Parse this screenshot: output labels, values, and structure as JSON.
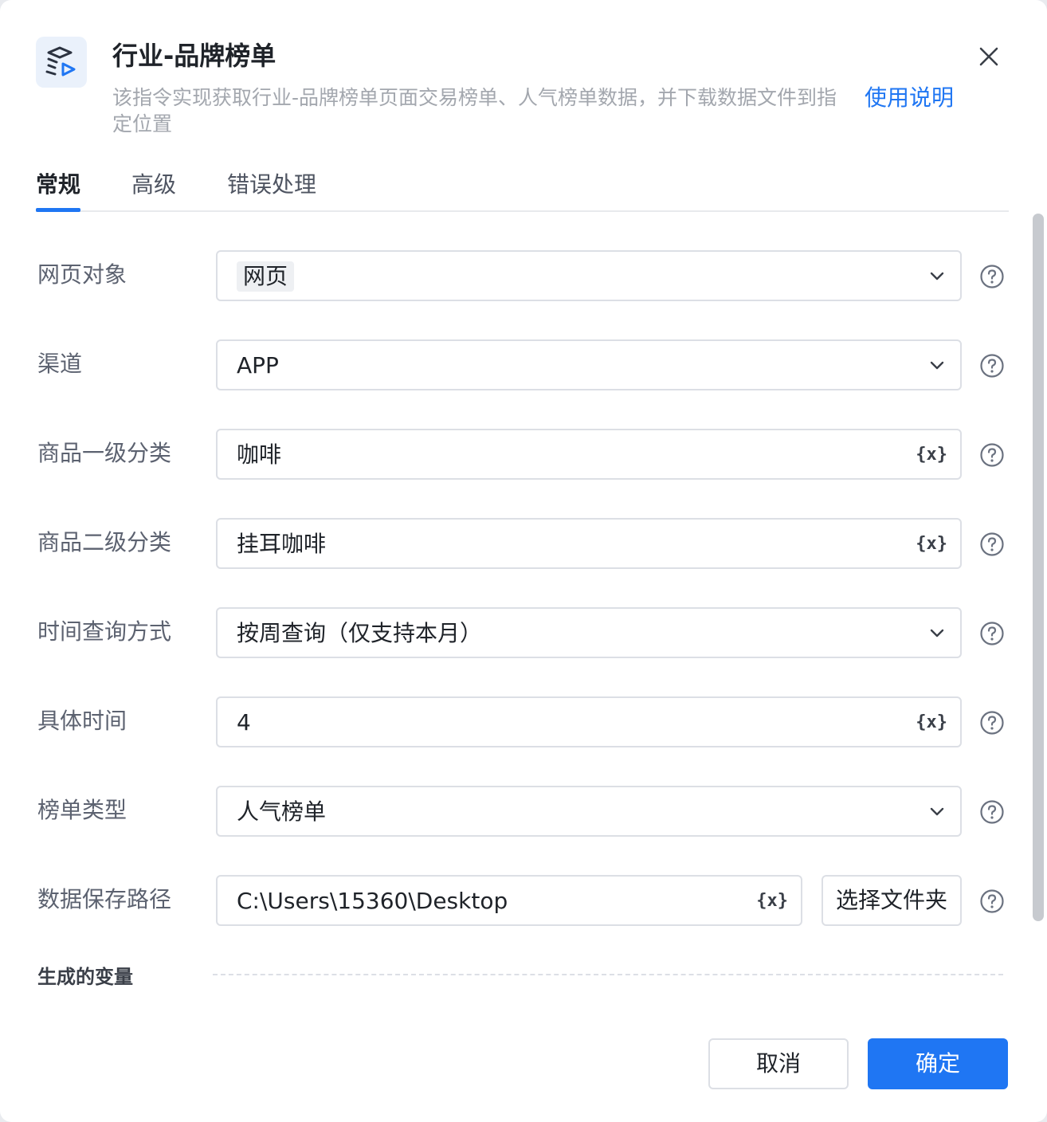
{
  "header": {
    "title": "行业-品牌榜单",
    "description": "该指令实现获取行业-品牌榜单页面交易榜单、人气榜单数据，并下载数据文件到指定位置",
    "help_link": "使用说明",
    "app_icon": "workflow-icon",
    "close_icon": "close-icon"
  },
  "tabs": [
    {
      "label": "常规",
      "active": true
    },
    {
      "label": "高级",
      "active": false
    },
    {
      "label": "错误处理",
      "active": false
    }
  ],
  "form": {
    "web_object": {
      "label": "网页对象",
      "value": "网页"
    },
    "channel": {
      "label": "渠道",
      "value": "APP"
    },
    "category_l1": {
      "label": "商品一级分类",
      "value": "咖啡"
    },
    "category_l2": {
      "label": "商品二级分类",
      "value": "挂耳咖啡"
    },
    "time_query_mode": {
      "label": "时间查询方式",
      "value": "按周查询（仅支持本月）"
    },
    "specific_time": {
      "label": "具体时间",
      "value": "4"
    },
    "ranking_type": {
      "label": "榜单类型",
      "value": "人气榜单"
    },
    "save_path": {
      "label": "数据保存路径",
      "value": "C:\\Users\\15360\\Desktop",
      "pick_button": "选择文件夹"
    }
  },
  "variable_icon_text": "{x}",
  "section": {
    "title": "生成的变量"
  },
  "footer": {
    "cancel": "取消",
    "ok": "确定"
  },
  "colors": {
    "accent": "#1f76f3",
    "text": "#1f2329",
    "label": "#5c6270",
    "border": "#dcdfe5"
  }
}
